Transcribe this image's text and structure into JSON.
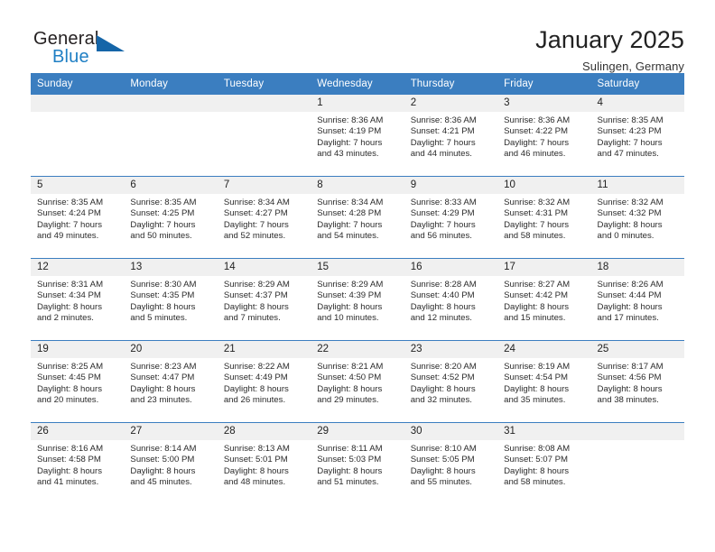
{
  "brand": {
    "name_top": "General",
    "name_bottom": "Blue",
    "triangle_color": "#1565a8",
    "blue_text_color": "#1f7fc4"
  },
  "header": {
    "title": "January 2025",
    "subtitle": "Sulingen, Germany"
  },
  "theme": {
    "header_bar_color": "#3b7ec0",
    "daynum_band_color": "#f0f0f0",
    "row_divider_color": "#3b7ec0"
  },
  "weekdays": [
    "Sunday",
    "Monday",
    "Tuesday",
    "Wednesday",
    "Thursday",
    "Friday",
    "Saturday"
  ],
  "weeks": [
    [
      {
        "day": "",
        "empty": true
      },
      {
        "day": "",
        "empty": true
      },
      {
        "day": "",
        "empty": true
      },
      {
        "day": "1",
        "sunrise": "Sunrise: 8:36 AM",
        "sunset": "Sunset: 4:19 PM",
        "daylight1": "Daylight: 7 hours",
        "daylight2": "and 43 minutes."
      },
      {
        "day": "2",
        "sunrise": "Sunrise: 8:36 AM",
        "sunset": "Sunset: 4:21 PM",
        "daylight1": "Daylight: 7 hours",
        "daylight2": "and 44 minutes."
      },
      {
        "day": "3",
        "sunrise": "Sunrise: 8:36 AM",
        "sunset": "Sunset: 4:22 PM",
        "daylight1": "Daylight: 7 hours",
        "daylight2": "and 46 minutes."
      },
      {
        "day": "4",
        "sunrise": "Sunrise: 8:35 AM",
        "sunset": "Sunset: 4:23 PM",
        "daylight1": "Daylight: 7 hours",
        "daylight2": "and 47 minutes."
      }
    ],
    [
      {
        "day": "5",
        "sunrise": "Sunrise: 8:35 AM",
        "sunset": "Sunset: 4:24 PM",
        "daylight1": "Daylight: 7 hours",
        "daylight2": "and 49 minutes."
      },
      {
        "day": "6",
        "sunrise": "Sunrise: 8:35 AM",
        "sunset": "Sunset: 4:25 PM",
        "daylight1": "Daylight: 7 hours",
        "daylight2": "and 50 minutes."
      },
      {
        "day": "7",
        "sunrise": "Sunrise: 8:34 AM",
        "sunset": "Sunset: 4:27 PM",
        "daylight1": "Daylight: 7 hours",
        "daylight2": "and 52 minutes."
      },
      {
        "day": "8",
        "sunrise": "Sunrise: 8:34 AM",
        "sunset": "Sunset: 4:28 PM",
        "daylight1": "Daylight: 7 hours",
        "daylight2": "and 54 minutes."
      },
      {
        "day": "9",
        "sunrise": "Sunrise: 8:33 AM",
        "sunset": "Sunset: 4:29 PM",
        "daylight1": "Daylight: 7 hours",
        "daylight2": "and 56 minutes."
      },
      {
        "day": "10",
        "sunrise": "Sunrise: 8:32 AM",
        "sunset": "Sunset: 4:31 PM",
        "daylight1": "Daylight: 7 hours",
        "daylight2": "and 58 minutes."
      },
      {
        "day": "11",
        "sunrise": "Sunrise: 8:32 AM",
        "sunset": "Sunset: 4:32 PM",
        "daylight1": "Daylight: 8 hours",
        "daylight2": "and 0 minutes."
      }
    ],
    [
      {
        "day": "12",
        "sunrise": "Sunrise: 8:31 AM",
        "sunset": "Sunset: 4:34 PM",
        "daylight1": "Daylight: 8 hours",
        "daylight2": "and 2 minutes."
      },
      {
        "day": "13",
        "sunrise": "Sunrise: 8:30 AM",
        "sunset": "Sunset: 4:35 PM",
        "daylight1": "Daylight: 8 hours",
        "daylight2": "and 5 minutes."
      },
      {
        "day": "14",
        "sunrise": "Sunrise: 8:29 AM",
        "sunset": "Sunset: 4:37 PM",
        "daylight1": "Daylight: 8 hours",
        "daylight2": "and 7 minutes."
      },
      {
        "day": "15",
        "sunrise": "Sunrise: 8:29 AM",
        "sunset": "Sunset: 4:39 PM",
        "daylight1": "Daylight: 8 hours",
        "daylight2": "and 10 minutes."
      },
      {
        "day": "16",
        "sunrise": "Sunrise: 8:28 AM",
        "sunset": "Sunset: 4:40 PM",
        "daylight1": "Daylight: 8 hours",
        "daylight2": "and 12 minutes."
      },
      {
        "day": "17",
        "sunrise": "Sunrise: 8:27 AM",
        "sunset": "Sunset: 4:42 PM",
        "daylight1": "Daylight: 8 hours",
        "daylight2": "and 15 minutes."
      },
      {
        "day": "18",
        "sunrise": "Sunrise: 8:26 AM",
        "sunset": "Sunset: 4:44 PM",
        "daylight1": "Daylight: 8 hours",
        "daylight2": "and 17 minutes."
      }
    ],
    [
      {
        "day": "19",
        "sunrise": "Sunrise: 8:25 AM",
        "sunset": "Sunset: 4:45 PM",
        "daylight1": "Daylight: 8 hours",
        "daylight2": "and 20 minutes."
      },
      {
        "day": "20",
        "sunrise": "Sunrise: 8:23 AM",
        "sunset": "Sunset: 4:47 PM",
        "daylight1": "Daylight: 8 hours",
        "daylight2": "and 23 minutes."
      },
      {
        "day": "21",
        "sunrise": "Sunrise: 8:22 AM",
        "sunset": "Sunset: 4:49 PM",
        "daylight1": "Daylight: 8 hours",
        "daylight2": "and 26 minutes."
      },
      {
        "day": "22",
        "sunrise": "Sunrise: 8:21 AM",
        "sunset": "Sunset: 4:50 PM",
        "daylight1": "Daylight: 8 hours",
        "daylight2": "and 29 minutes."
      },
      {
        "day": "23",
        "sunrise": "Sunrise: 8:20 AM",
        "sunset": "Sunset: 4:52 PM",
        "daylight1": "Daylight: 8 hours",
        "daylight2": "and 32 minutes."
      },
      {
        "day": "24",
        "sunrise": "Sunrise: 8:19 AM",
        "sunset": "Sunset: 4:54 PM",
        "daylight1": "Daylight: 8 hours",
        "daylight2": "and 35 minutes."
      },
      {
        "day": "25",
        "sunrise": "Sunrise: 8:17 AM",
        "sunset": "Sunset: 4:56 PM",
        "daylight1": "Daylight: 8 hours",
        "daylight2": "and 38 minutes."
      }
    ],
    [
      {
        "day": "26",
        "sunrise": "Sunrise: 8:16 AM",
        "sunset": "Sunset: 4:58 PM",
        "daylight1": "Daylight: 8 hours",
        "daylight2": "and 41 minutes."
      },
      {
        "day": "27",
        "sunrise": "Sunrise: 8:14 AM",
        "sunset": "Sunset: 5:00 PM",
        "daylight1": "Daylight: 8 hours",
        "daylight2": "and 45 minutes."
      },
      {
        "day": "28",
        "sunrise": "Sunrise: 8:13 AM",
        "sunset": "Sunset: 5:01 PM",
        "daylight1": "Daylight: 8 hours",
        "daylight2": "and 48 minutes."
      },
      {
        "day": "29",
        "sunrise": "Sunrise: 8:11 AM",
        "sunset": "Sunset: 5:03 PM",
        "daylight1": "Daylight: 8 hours",
        "daylight2": "and 51 minutes."
      },
      {
        "day": "30",
        "sunrise": "Sunrise: 8:10 AM",
        "sunset": "Sunset: 5:05 PM",
        "daylight1": "Daylight: 8 hours",
        "daylight2": "and 55 minutes."
      },
      {
        "day": "31",
        "sunrise": "Sunrise: 8:08 AM",
        "sunset": "Sunset: 5:07 PM",
        "daylight1": "Daylight: 8 hours",
        "daylight2": "and 58 minutes."
      },
      {
        "day": "",
        "empty": true
      }
    ]
  ]
}
